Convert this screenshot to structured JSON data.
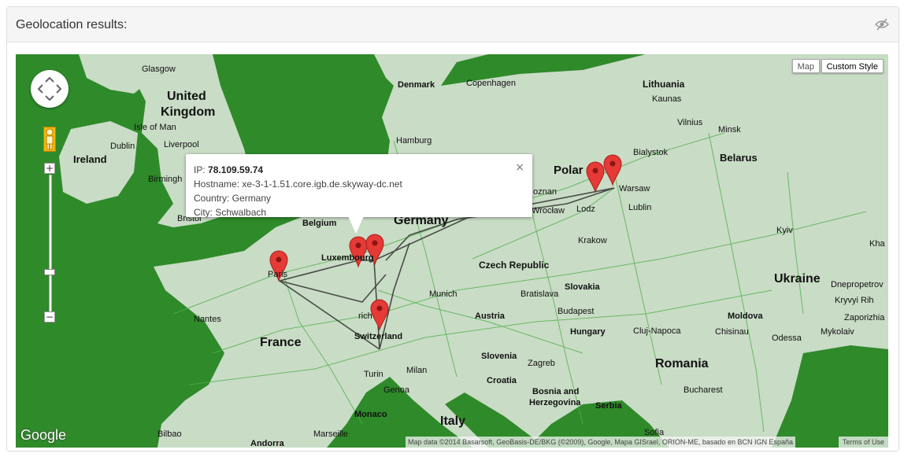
{
  "panel": {
    "title": "Geolocation results:",
    "hide_icon": "eye-slash-icon"
  },
  "map_controls": {
    "map_type_map": "Map",
    "map_type_custom": "Custom Style",
    "zoom_in": "+",
    "zoom_out": "−",
    "pan_icon": "pan-control-icon",
    "pegman_icon": "street-view-pegman-icon"
  },
  "info_window": {
    "ip_label": "IP:",
    "ip_value": "78.109.59.74",
    "hostname": "Hostname: xe-3-1-1.51.core.igb.de.skyway-dc.net",
    "country": "Country: Germany",
    "city": "City: Schwalbach",
    "close": "×"
  },
  "footer": {
    "google": "Google",
    "attribution": "Map data ©2014 Basarsoft, GeoBasis-DE/BKG (©2009), Google, Mapa GISrael, ORION-ME, basado en BCN IGN España",
    "terms": "Terms of Use"
  },
  "map_labels": {
    "glasgow": "Glasgow",
    "united_kingdom_1": "United",
    "united_kingdom_2": "Kingdom",
    "isle_of_man": "Isle of Man",
    "dublin": "Dublin",
    "ireland": "Ireland",
    "liverpool": "Liverpool",
    "birmingham": "Birmingh",
    "bristol": "Bristol",
    "denmark": "Denmark",
    "copenhagen": "Copenhagen",
    "hamburg": "Hamburg",
    "lithuania": "Lithuania",
    "kaunas": "Kaunas",
    "vilnius": "Vilnius",
    "minsk": "Minsk",
    "bialystok": "Bialystok",
    "belarus": "Belarus",
    "poland": "Polar",
    "poznan": "oznan",
    "warsaw": "Warsaw",
    "lodz": "Lodz",
    "lublin": "Lublin",
    "wroclaw": "Wrocław",
    "belgium": "Belgium",
    "germany": "Germany",
    "luxembourg": "Luxembourg",
    "paris": "Paris",
    "krakow": "Krakow",
    "czech_republic": "Czech Republic",
    "kyiv": "Kyiv",
    "kha": "Kha",
    "ukraine": "Ukraine",
    "dnepropetrovsk": "Dnepropetrov",
    "kryvyi_rih": "Kryvyi Rih",
    "zaporizhia": "Zaporizhia",
    "slovakia": "Slovakia",
    "bratislava": "Bratislava",
    "munich": "Munich",
    "nantes": "Nantes",
    "zurich": "rich",
    "austria": "Austria",
    "budapest": "Budapest",
    "switzerland": "Switzerland",
    "moldova": "Moldova",
    "hungary": "Hungary",
    "cluj_napoca": "Cluj-Napoca",
    "chisinau": "Chisinau",
    "odessa": "Odessa",
    "mykolaiv": "Mykolaiv",
    "france": "France",
    "slovenia": "Slovenia",
    "zagreb": "Zagreb",
    "romania": "Romania",
    "turin": "Turin",
    "milan": "Milan",
    "croatia": "Croatia",
    "genoa": "Genoa",
    "bosnia_1": "Bosnia and",
    "bosnia_2": "Herzegovina",
    "serbia": "Serbia",
    "bucharest": "Bucharest",
    "monaco": "Monaco",
    "italy": "Italy",
    "bilbao": "Bilbao",
    "marseille": "Marseille",
    "sofia": "Sofia",
    "andorra": "Andorra"
  },
  "colors": {
    "sea": "#2f8a2a",
    "land": "#c9dcc6",
    "road": "#4fb14a",
    "marker": "#e53a36",
    "route": "#333333"
  }
}
